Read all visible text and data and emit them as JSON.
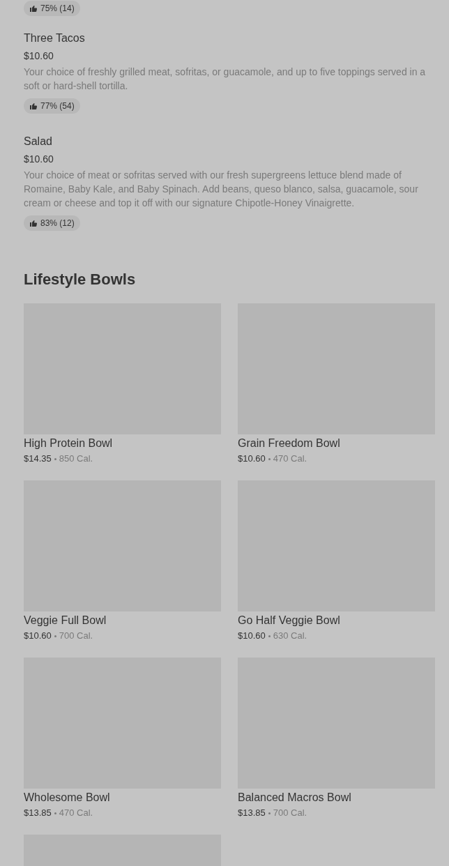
{
  "menu_items": [
    {
      "rating": "75% (14)"
    },
    {
      "name": "Three Tacos",
      "price": "$10.60",
      "description": "Your choice of freshly grilled meat, sofritas, or guacamole, and up to five toppings served in a soft or hard-shell tortilla.",
      "rating": "77% (54)"
    },
    {
      "name": "Salad",
      "price": "$10.60",
      "description": "Your choice of meat or sofritas served with our fresh supergreens lettuce blend made of Romaine, Baby Kale, and Baby Spinach. Add beans, queso blanco, salsa, guacamole, sour cream or cheese and top it off with our signature Chipotle-Honey Vinaigrette.",
      "rating": "83% (12)"
    }
  ],
  "section": {
    "title": "Lifestyle Bowls",
    "cards": [
      {
        "name": "High Protein Bowl",
        "price": "$14.35",
        "calories": "850 Cal."
      },
      {
        "name": "Grain Freedom Bowl",
        "price": "$10.60",
        "calories": "470 Cal."
      },
      {
        "name": "Veggie Full Bowl",
        "price": "$10.60",
        "calories": "700 Cal."
      },
      {
        "name": "Go Half Veggie Bowl",
        "price": "$10.60",
        "calories": "630 Cal."
      },
      {
        "name": "Wholesome Bowl",
        "price": "$13.85",
        "calories": "470 Cal."
      },
      {
        "name": "Balanced Macros Bowl",
        "price": "$13.85",
        "calories": "700 Cal."
      },
      {
        "kind": "picture"
      }
    ]
  }
}
